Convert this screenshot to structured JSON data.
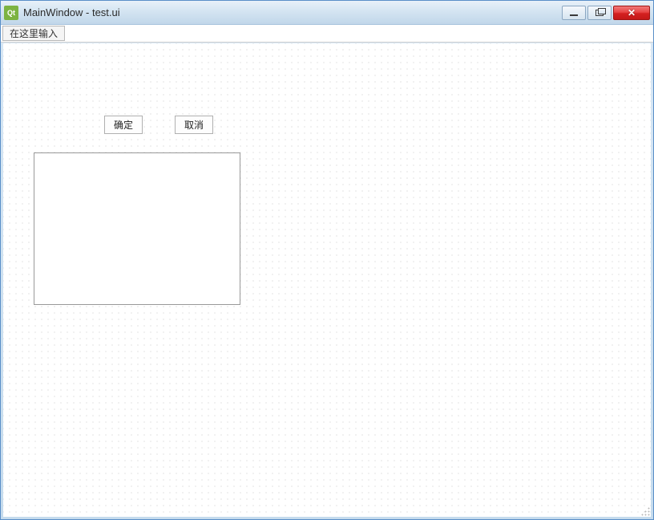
{
  "titlebar": {
    "icon_label": "Qt",
    "title": "MainWindow - test.ui"
  },
  "menubar": {
    "input_hint": "在这里输入"
  },
  "buttons": {
    "ok": "确定",
    "cancel": "取消"
  },
  "textedit": {
    "value": ""
  }
}
